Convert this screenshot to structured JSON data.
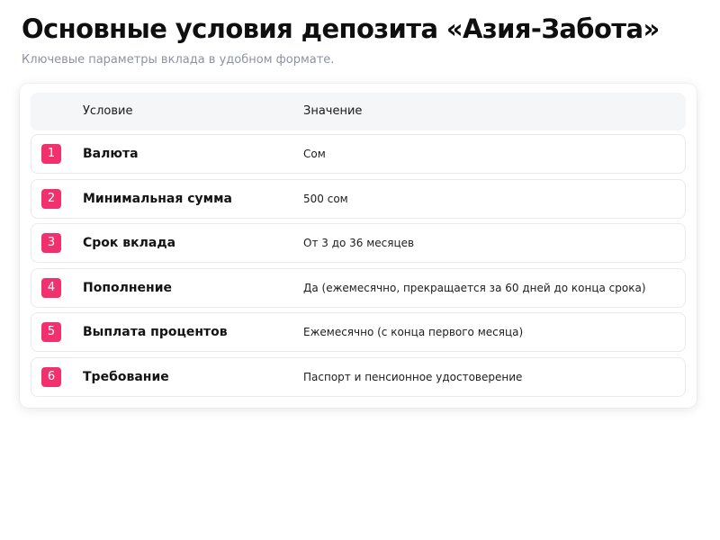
{
  "page": {
    "title": "Основные условия депозита «Азия-Забота»",
    "subtitle": "Ключевые параметры вклада в удобном формате."
  },
  "table": {
    "headers": {
      "condition": "Условие",
      "value": "Значение"
    },
    "rows": [
      {
        "number": "1",
        "label": "Валюта",
        "value": "Сом"
      },
      {
        "number": "2",
        "label": "Минимальная сумма",
        "value": "500 сом"
      },
      {
        "number": "3",
        "label": "Срок вклада",
        "value": "От 3 до 36 месяцев"
      },
      {
        "number": "4",
        "label": "Пополнение",
        "value": "Да (ежемесячно, прекращается за 60 дней до конца срока)"
      },
      {
        "number": "5",
        "label": "Выплата процентов",
        "value": "Ежемесячно (с конца первого месяца)"
      },
      {
        "number": "6",
        "label": "Требование",
        "value": "Паспорт и пенсионное удостоверение"
      }
    ]
  },
  "colors": {
    "accent": "#f0316d",
    "subtitle": "#8b93a3",
    "header_bg": "#f5f6f8",
    "row_border": "#e8eaef"
  }
}
